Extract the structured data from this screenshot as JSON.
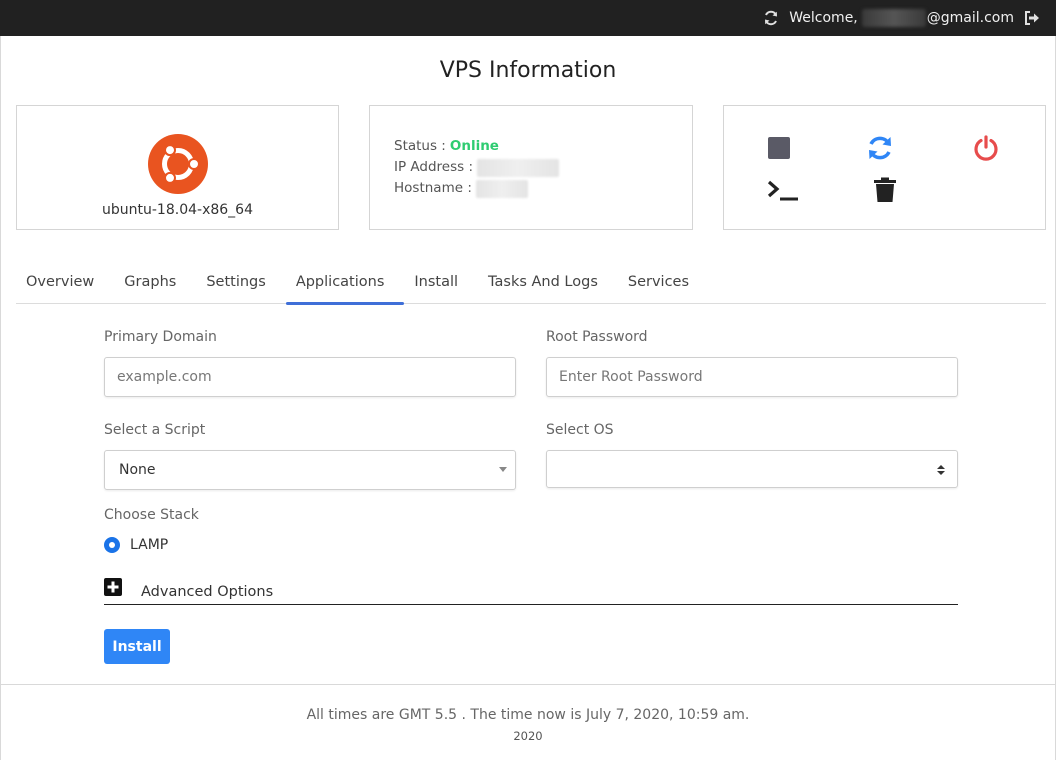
{
  "topbar": {
    "welcome_prefix": "Welcome,",
    "email_suffix": "@gmail.com"
  },
  "page": {
    "title": "VPS Information"
  },
  "os_card": {
    "name": "ubuntu-18.04-x86_64",
    "logo_color": "#e95420"
  },
  "info_card": {
    "status_label": "Status :",
    "status_value": "Online",
    "ip_label": "IP Address :",
    "hostname_label": "Hostname :"
  },
  "actions": {
    "stop": "stop-square-icon",
    "restart": "refresh-icon",
    "power": "power-icon",
    "console": "terminal-icon",
    "delete": "trash-icon",
    "colors": {
      "stop": "#5a5a66",
      "restart": "#2f86f6",
      "power": "#e74c4c",
      "console": "#222222",
      "delete": "#222222"
    }
  },
  "tabs": [
    {
      "label": "Overview"
    },
    {
      "label": "Graphs"
    },
    {
      "label": "Settings"
    },
    {
      "label": "Applications",
      "active": true
    },
    {
      "label": "Install"
    },
    {
      "label": "Tasks And Logs"
    },
    {
      "label": "Services"
    }
  ],
  "form": {
    "primary_domain_label": "Primary Domain",
    "primary_domain_placeholder": "example.com",
    "root_password_label": "Root Password",
    "root_password_placeholder": "Enter Root Password",
    "script_label": "Select a Script",
    "script_selected": "None",
    "os_label": "Select OS",
    "os_selected": "",
    "stack_label": "Choose Stack",
    "stack_option": "LAMP",
    "advanced_label": "Advanced Options",
    "install_button": "Install"
  },
  "footer": {
    "line1": "All times are GMT 5.5 . The time now is July 7, 2020, 10:59 am.",
    "line2": "2020"
  }
}
